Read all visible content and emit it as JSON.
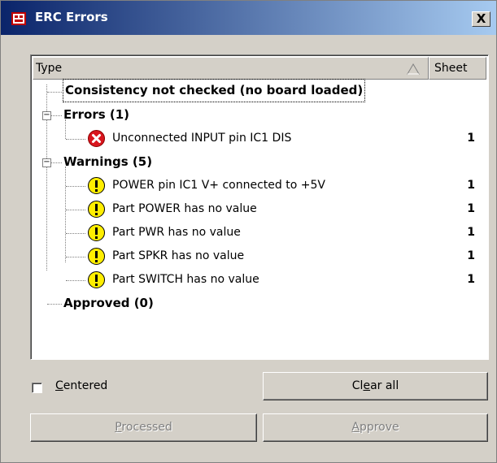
{
  "window": {
    "title": "ERC Errors",
    "close_label": "X"
  },
  "list": {
    "columns": {
      "type": "Type",
      "sheet": "Sheet"
    },
    "consistency": "Consistency not checked (no board loaded)",
    "errors_label": "Errors (1)",
    "errors": [
      {
        "text": "Unconnected INPUT pin IC1 DIS",
        "sheet": "1"
      }
    ],
    "warnings_label": "Warnings (5)",
    "warnings": [
      {
        "text": "POWER pin IC1 V+ connected to +5V",
        "sheet": "1"
      },
      {
        "text": "Part POWER has no value",
        "sheet": "1"
      },
      {
        "text": "Part PWR has no value",
        "sheet": "1"
      },
      {
        "text": "Part SPKR has no value",
        "sheet": "1"
      },
      {
        "text": "Part SWITCH has no value",
        "sheet": "1"
      }
    ],
    "approved_label": "Approved (0)"
  },
  "controls": {
    "centered_pre": "",
    "centered_mnemonic": "C",
    "centered_post": "entered",
    "centered_checked": false,
    "clear_all_pre": "Cl",
    "clear_all_mnemonic": "e",
    "clear_all_post": "ar all",
    "processed_pre": "",
    "processed_mnemonic": "P",
    "processed_post": "rocessed",
    "approve_pre": "",
    "approve_mnemonic": "A",
    "approve_post": "pprove"
  },
  "colors": {
    "titlebar_start": "#0a246a",
    "titlebar_end": "#a6caf0",
    "error_icon": "#d9161e",
    "warning_icon": "#ffee00"
  }
}
